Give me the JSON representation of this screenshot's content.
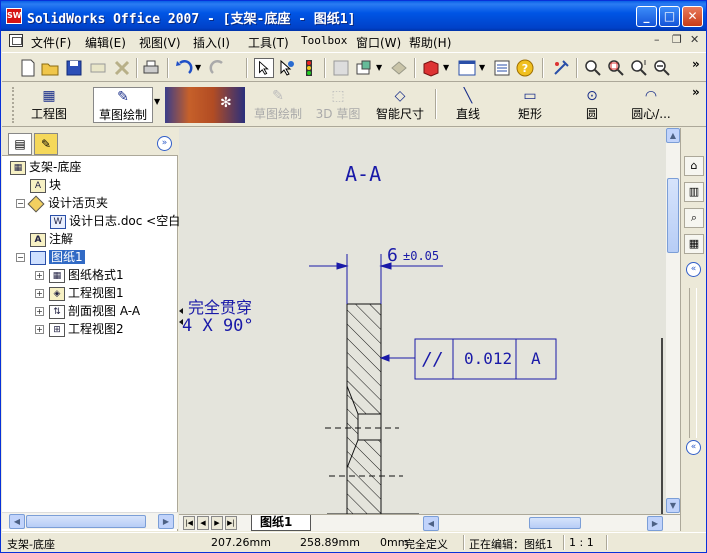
{
  "window": {
    "title": "SolidWorks Office 2007 - [支架-底座 - 图纸1]",
    "app_icon_label": "SW",
    "controls": {
      "minimize": "_",
      "maximize": "□",
      "close": "✕"
    }
  },
  "menubar": {
    "items": [
      "文件(F)",
      "编辑(E)",
      "视图(V)",
      "插入(I)",
      "工具(T)",
      "Toolbox",
      "窗口(W)",
      "帮助(H)"
    ],
    "mdi_controls": [
      "–",
      "❐",
      "✕"
    ]
  },
  "toolbar_std": {
    "icons": [
      "new-icon",
      "open-icon",
      "save-icon",
      "print-setup-icon",
      "publish-icon",
      "print-icon",
      "undo-icon",
      "redo-icon",
      "select-icon",
      "select-other-icon",
      "traffic-light-icon",
      "grid-icon",
      "layer-icon",
      "hide-icon",
      "3d-box-icon",
      "view-palette-icon",
      "options-icon",
      "help-icon",
      "rebuild-icon",
      "zoom-fit-icon",
      "zoom-area-icon",
      "zoom-in-out-icon",
      "zoom-out-icon"
    ],
    "overflow": "»"
  },
  "toolbar_cmd": {
    "items": [
      {
        "label": "工程图",
        "icon": "drawing-icon",
        "enabled": true
      },
      {
        "label": "草图绘制",
        "icon": "sketch-icon",
        "enabled": true
      },
      {
        "label": "草图绘制",
        "icon": "sketch-disabled-icon",
        "enabled": false
      },
      {
        "label": "3D 草图",
        "icon": "3d-sketch-icon",
        "enabled": false
      },
      {
        "label": "智能尺寸",
        "icon": "smart-dimension-icon",
        "enabled": true
      },
      {
        "label": "直线",
        "icon": "line-icon",
        "enabled": true
      },
      {
        "label": "矩形",
        "icon": "rectangle-icon",
        "enabled": true
      },
      {
        "label": "圆",
        "icon": "circle-icon",
        "enabled": true
      },
      {
        "label": "圆心/...",
        "icon": "arc-icon",
        "enabled": true
      }
    ],
    "overflow": "»"
  },
  "tree": {
    "root": "支架-底座",
    "items": [
      {
        "label": "块",
        "icon": "block-icon"
      },
      {
        "label": "设计活页夹",
        "icon": "design-binder-icon"
      },
      {
        "label": "设计日志.doc <空白",
        "icon": "doc-icon"
      },
      {
        "label": "注解",
        "icon": "annotation-icon"
      },
      {
        "label": "图纸1",
        "icon": "sheet-icon"
      },
      {
        "label": "图纸格式1",
        "icon": "sheet-format-icon"
      },
      {
        "label": "工程视图1",
        "icon": "drawing-view-icon"
      },
      {
        "label": "剖面视图 A-A",
        "icon": "section-view-icon"
      },
      {
        "label": "工程视图2",
        "icon": "drawing-view-icon"
      }
    ]
  },
  "drawing": {
    "section_title": "A-A",
    "dimension_value": "6",
    "dimension_tolerance": "±0.05",
    "hole_note_line1": "完全贯穿",
    "hole_note_line2": "4 X 90°",
    "fcf": {
      "symbol": "//",
      "tolerance": "0.012",
      "datum": "A"
    },
    "line_color": "#1a1aa8"
  },
  "bottombar": {
    "sheet_tab": "图纸1"
  },
  "status": {
    "part": "支架-底座",
    "x": "207.26mm",
    "y": "258.89mm",
    "z": "0mm",
    "define_state": "完全定义",
    "editing": "正在编辑：图纸1",
    "scale": "1 : 1"
  }
}
